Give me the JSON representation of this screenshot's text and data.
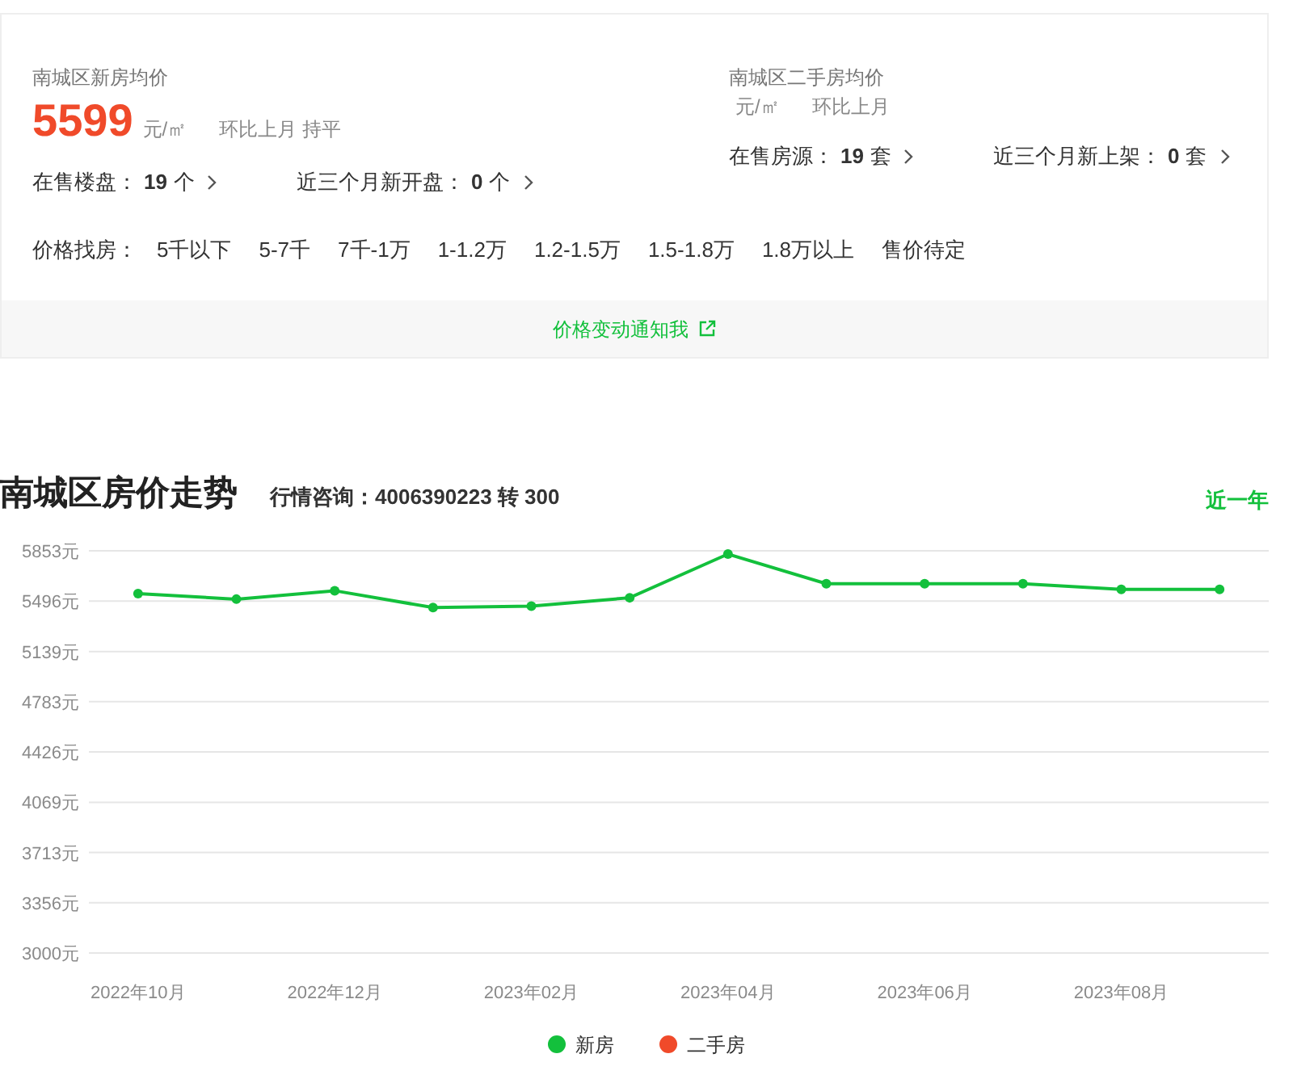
{
  "new_price": {
    "title": "南城区新房均价",
    "price": "5599",
    "unit": "元/㎡",
    "change": "环比上月 持平"
  },
  "second_price": {
    "title": "南城区二手房均价",
    "unit": "元/㎡",
    "change": "环比上月"
  },
  "new_stats": [
    {
      "label": "在售楼盘：",
      "value": "19",
      "suffix": "个"
    },
    {
      "label": "近三个月新开盘：",
      "value": "0",
      "suffix": "个"
    }
  ],
  "second_stats": [
    {
      "label": "在售房源：",
      "value": "19",
      "suffix": "套"
    },
    {
      "label": "近三个月新上架：",
      "value": "0",
      "suffix": "套"
    }
  ],
  "price_filter": {
    "label": "价格找房：",
    "options": [
      "5千以下",
      "5-7千",
      "7千-1万",
      "1-1.2万",
      "1.2-1.5万",
      "1.5-1.8万",
      "1.8万以上",
      "售价待定"
    ]
  },
  "notify": "价格变动通知我",
  "trend": {
    "title": "南城区房价走势",
    "hotline": "行情咨询：4006390223 转 300",
    "range": "近一年",
    "chart_data": {
      "type": "line",
      "grid": true,
      "categories": [
        "2022年10月",
        null,
        "2022年12月",
        null,
        "2023年02月",
        null,
        "2023年04月",
        null,
        "2023年06月",
        null,
        "2023年08月",
        null
      ],
      "series": [
        {
          "name": "新房",
          "color": "#13c03c",
          "marker": "circle",
          "values": [
            5550,
            5510,
            5570,
            5450,
            5460,
            5520,
            5830,
            5620,
            5620,
            5620,
            5580,
            5580
          ]
        },
        {
          "name": "二手房",
          "color": "#f04a2a",
          "values": [
            null,
            null,
            null,
            null,
            null,
            null,
            null,
            null,
            null,
            null,
            null,
            null
          ]
        }
      ],
      "ylim": [
        3000,
        5853
      ],
      "yticks": [
        {
          "value": 3000,
          "label": "3000元"
        },
        {
          "value": 3356,
          "label": "3356元"
        },
        {
          "value": 3713,
          "label": "3713元"
        },
        {
          "value": 4069,
          "label": "4069元"
        },
        {
          "value": 4426,
          "label": "4426元"
        },
        {
          "value": 4783,
          "label": "4783元"
        },
        {
          "value": 5139,
          "label": "5139元"
        },
        {
          "value": 5496,
          "label": "5496元"
        },
        {
          "value": 5853,
          "label": "5853元"
        }
      ]
    }
  }
}
